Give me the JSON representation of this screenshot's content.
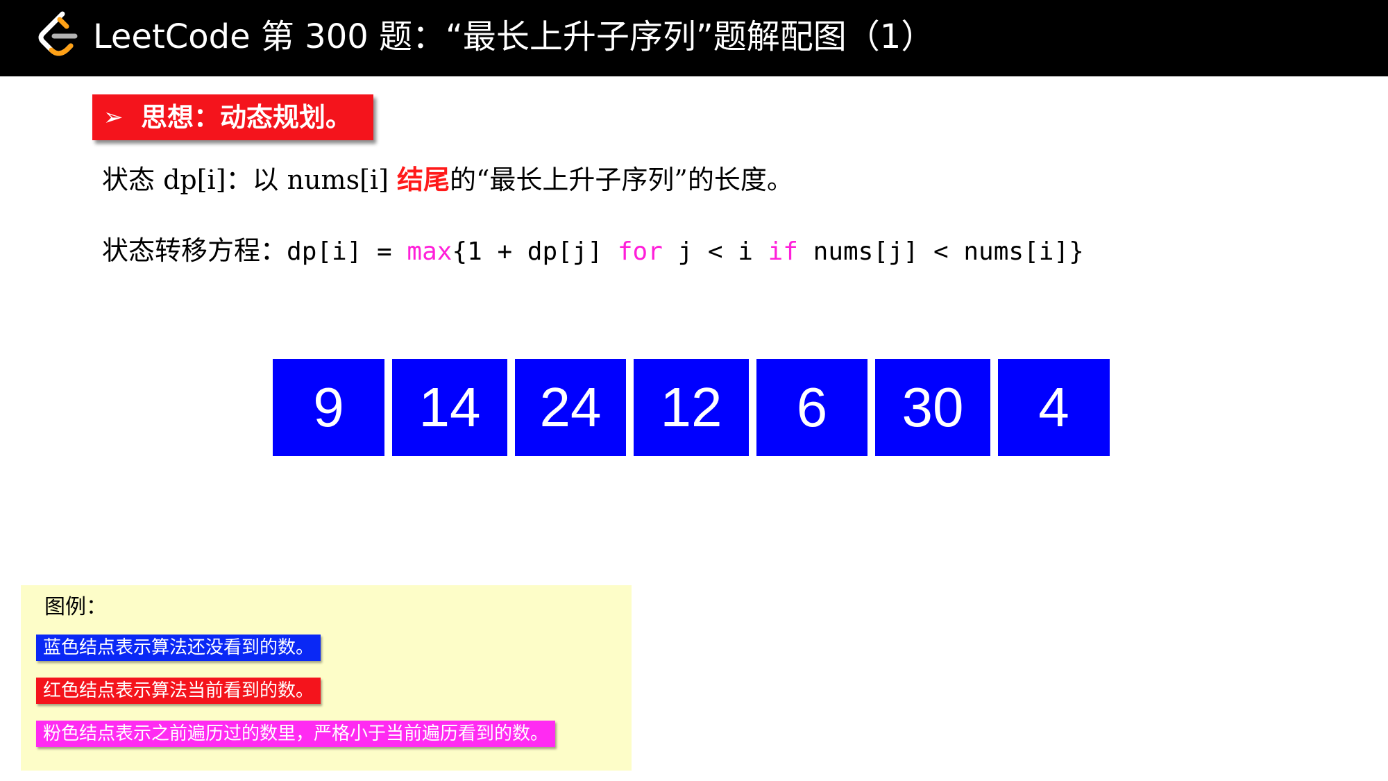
{
  "header": {
    "title": "LeetCode 第 300 题：“最长上升子序列”题解配图（1）"
  },
  "idea": {
    "arrow": "➢",
    "label": "思想：动态规划。"
  },
  "state": {
    "prefix": "状态 dp[i]：以 nums[i] ",
    "highlight": "结尾",
    "suffix": "的“最长上升子序列”的长度。"
  },
  "transfer": {
    "label": "状态转移方程：",
    "code_a": "dp[i] = ",
    "kw_max": "max",
    "code_b": "{1 + dp[j] ",
    "kw_for": "for",
    "code_c": " j < i ",
    "kw_if": "if",
    "code_d": " nums[j] < nums[i]}"
  },
  "array": {
    "values": [
      "9",
      "14",
      "24",
      "12",
      "6",
      "30",
      "4"
    ],
    "cell_color": "#0000ff"
  },
  "legend": {
    "title": "图例：",
    "items": [
      {
        "text": "蓝色结点表示算法还没看到的数。",
        "color": "#0a28f5"
      },
      {
        "text": "红色结点表示算法当前看到的数。",
        "color": "#f4141c"
      },
      {
        "text": "粉色结点表示之前遍历过的数里，严格小于当前遍历看到的数。",
        "color": "#ff2bf2"
      }
    ]
  },
  "colors": {
    "header_bg": "#000000",
    "idea_bg": "#f4141c",
    "keyword": "#ff1fd9",
    "highlight": "#ff1a1a",
    "legend_bg": "#fdfdc8"
  }
}
